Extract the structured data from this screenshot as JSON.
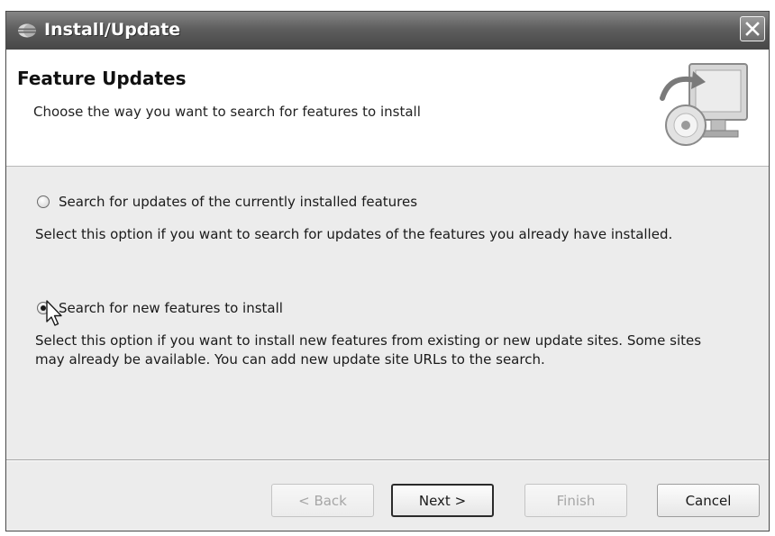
{
  "window": {
    "title": "Install/Update",
    "icon": "eclipse-icon",
    "close_icon": "close-icon"
  },
  "header": {
    "title": "Feature Updates",
    "description": "Choose the way you want to search for features to install",
    "graphic": "update-monitor-cd-icon"
  },
  "options": [
    {
      "label": "Search for updates of the currently installed features",
      "description": "Select this option if you want to search for updates of the features you already have installed.",
      "selected": false
    },
    {
      "label": "Search for new features to install",
      "description": "Select this option if you want to install new features from existing or new update sites. Some sites may already be available. You can add new update site URLs to the search.",
      "selected": true
    }
  ],
  "buttons": {
    "back": "< Back",
    "next": "Next >",
    "finish": "Finish",
    "cancel": "Cancel"
  },
  "colors": {
    "titlebar": "#5e5e5e",
    "dialog_bg": "#ececec",
    "disabled_text": "#a6a6a6"
  }
}
